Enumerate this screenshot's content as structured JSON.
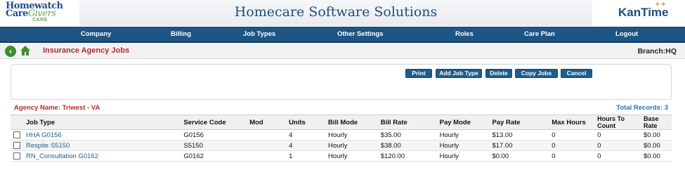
{
  "header": {
    "logo_left": {
      "line1": "Homewatch",
      "line2a": "Care",
      "line2b": "Givers",
      "line3": "CARE"
    },
    "app_title": "Homecare Software Solutions",
    "logo_right": "KanTime"
  },
  "nav": {
    "items": [
      "Company",
      "Billing",
      "Job Types",
      "Other Settings",
      "Roles",
      "Care Plan",
      "Logout"
    ]
  },
  "subbar": {
    "page_title": "Insurance Agency Jobs",
    "branch_label": "Branch:",
    "branch_value": "HQ"
  },
  "actions": {
    "print": "Print",
    "add_job_type": "Add Job Type",
    "delete": "Delete",
    "copy_jobs": "Copy Jobs",
    "cancel": "Cancel"
  },
  "info": {
    "agency_name": "Agency Name: Triwest - VA",
    "total_records": "Total Records: 3"
  },
  "table": {
    "headers": {
      "job_type": "Job Type",
      "service_code": "Service Code",
      "mod": "Mod",
      "units": "Units",
      "bill_mode": "Bill Mode",
      "bill_rate": "Bill Rate",
      "pay_mode": "Pay Mode",
      "pay_rate": "Pay Rate",
      "max_hours": "Max Hours",
      "hours_to_count_1": "Hours To",
      "hours_to_count_2": "Count",
      "base_rate_1": "Base",
      "base_rate_2": "Rate"
    },
    "rows": [
      {
        "job_type": "HHA G0156",
        "service_code": "G0156",
        "mod": "",
        "units": "4",
        "bill_mode": "Hourly",
        "bill_rate": "$35.00",
        "pay_mode": "Hourly",
        "pay_rate": "$13.00",
        "max_hours": "0",
        "hours_to_count": "0",
        "base_rate": "$0.00"
      },
      {
        "job_type": "Respite S5150",
        "service_code": "S5150",
        "mod": "",
        "units": "4",
        "bill_mode": "Hourly",
        "bill_rate": "$38.00",
        "pay_mode": "Hourly",
        "pay_rate": "$17.00",
        "max_hours": "0",
        "hours_to_count": "0",
        "base_rate": "$0.00"
      },
      {
        "job_type": "RN_Consultation G0162",
        "service_code": "G0162",
        "mod": "",
        "units": "1",
        "bill_mode": "Hourly",
        "bill_rate": "$120.00",
        "pay_mode": "Hourly",
        "pay_rate": "$0.00",
        "max_hours": "0",
        "hours_to_count": "0",
        "base_rate": "$0.00"
      }
    ]
  },
  "colors": {
    "nav_bg": "#1e5583",
    "button_bg": "#1f5c8b",
    "title_red": "#b42a2a",
    "link_blue": "#1f5c8b"
  }
}
